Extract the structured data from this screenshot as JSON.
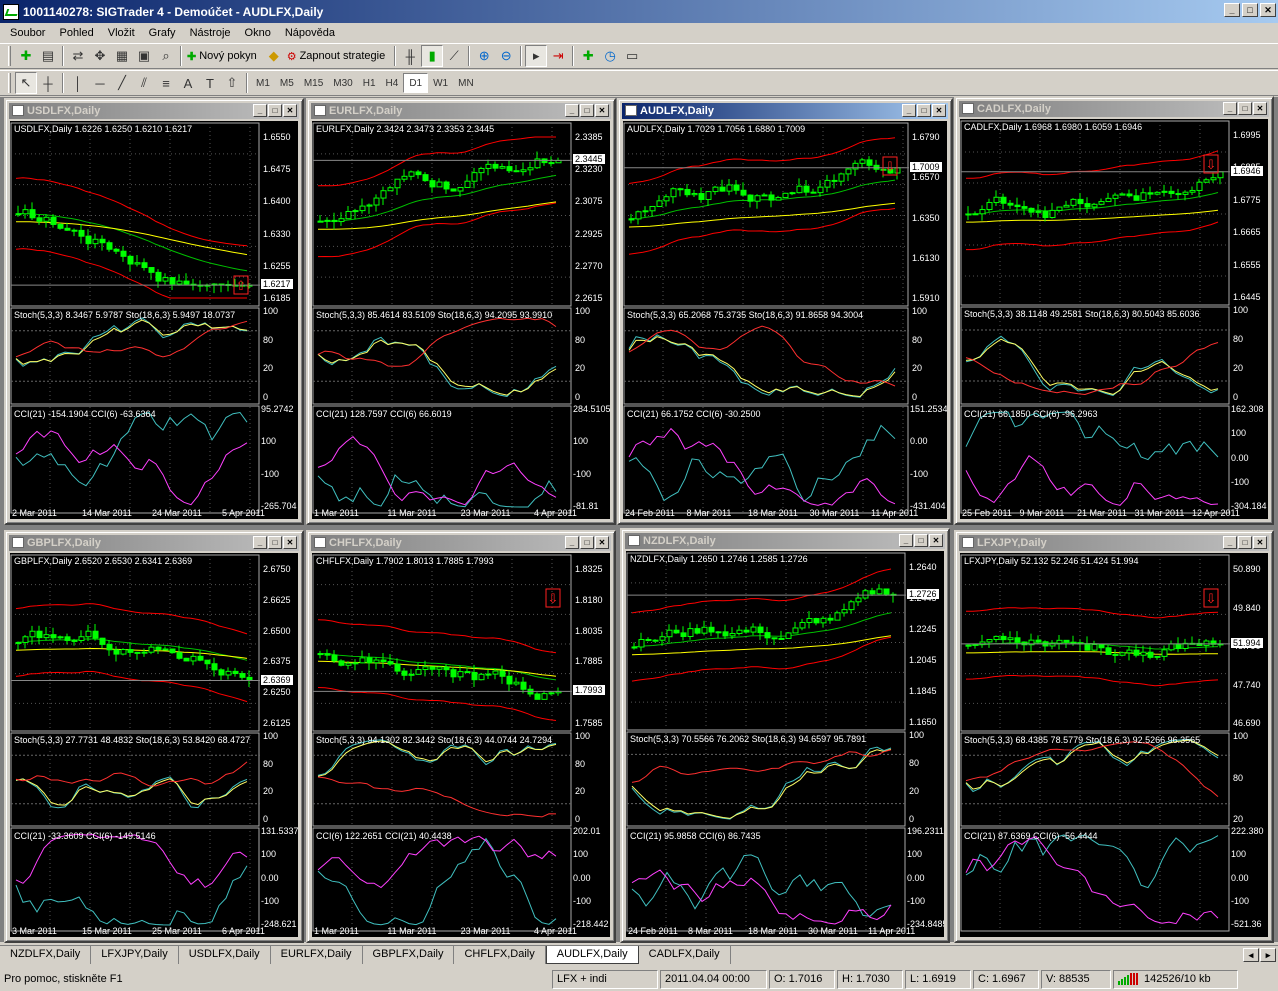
{
  "app": {
    "title": "1001140278: SIGTrader 4 - Demoúčet - AUDLFX,Daily"
  },
  "menu": [
    "Soubor",
    "Pohled",
    "Vložit",
    "Grafy",
    "Nástroje",
    "Okno",
    "Nápověda"
  ],
  "toolbar": {
    "new_order": "Nový pokyn",
    "strategy": "Zapnout strategie"
  },
  "timeframes": [
    "M1",
    "M5",
    "M15",
    "M30",
    "H1",
    "H4",
    "D1",
    "W1",
    "MN"
  ],
  "active_timeframe": "D1",
  "colors": {
    "candle_up": "#00ff00",
    "candle_down": "#00ff00",
    "bands": "#ff0000",
    "ma_fast": "#00c000",
    "ma_slow": "#ffff00",
    "stoch_main": "#ffff66",
    "stoch_signal": "#ff3030",
    "stoch_slow": "#40c0c0",
    "cci_a": "#40c0c0",
    "cci_b": "#ff40ff"
  },
  "windows": [
    {
      "title": "USDLFX,Daily",
      "header": "USDLFX,Daily  1.6226 1.6250 1.6210 1.6217",
      "prices": [
        "1.6550",
        "1.6475",
        "1.6400",
        "1.6330",
        "1.6255",
        "1.6185"
      ],
      "current": "1.6217",
      "stoch": "Stoch(5,3,3) 8.3467 5.9787  Sto(18,6,3) 5.9497 18.0737",
      "stoch_levels": [
        "100",
        "80",
        "20",
        "0"
      ],
      "cci": "CCI(21) -154.1904  CCI(6) -63.6364",
      "cci_levels": [
        "95.2742",
        "100",
        "-100",
        "-265.704"
      ],
      "dates": [
        "2 Mar 2011",
        "14 Mar 2011",
        "24 Mar 2011",
        "5 Apr 2011"
      ],
      "trend": -1,
      "arrow": "up"
    },
    {
      "title": "EURLFX,Daily",
      "header": "EURLFX,Daily  2.3424 2.3473 2.3353 2.3445",
      "prices": [
        "2.3385",
        "2.3230",
        "2.3075",
        "2.2925",
        "2.2770",
        "2.2615"
      ],
      "current": "2.3445",
      "stoch": "Stoch(5,3,3) 85.4614 83.5109  Sto(18,6,3) 94.2095 93.9910",
      "stoch_levels": [
        "100",
        "80",
        "20",
        "0"
      ],
      "cci": "CCI(21) 128.7597  CCI(6) 66.6019",
      "cci_levels": [
        "284.5105",
        "100",
        "-100",
        "-81.81"
      ],
      "dates": [
        "1 Mar 2011",
        "11 Mar 2011",
        "23 Mar 2011",
        "4 Apr 2011"
      ],
      "trend": 1,
      "arrow": ""
    },
    {
      "title": "AUDLFX,Daily",
      "header": "AUDLFX,Daily  1.7029 1.7056 1.6880 1.7009",
      "prices": [
        "1.6790",
        "1.6570",
        "1.6350",
        "1.6130",
        "1.5910"
      ],
      "current": "1.7009",
      "stoch": "Stoch(5,3,3) 65.2068 75.3735  Sto(18,6,3) 91.8658 94.3004",
      "stoch_levels": [
        "100",
        "80",
        "20",
        "0"
      ],
      "cci": "CCI(21) 66.1752  CCI(6) -30.2500",
      "cci_levels": [
        "151.2534",
        "0.00",
        "-100",
        "-431.404"
      ],
      "dates": [
        "24 Feb 2011",
        "8 Mar 2011",
        "18 Mar 2011",
        "30 Mar 2011",
        "11 Apr 2011"
      ],
      "trend": 0.5,
      "arrow": "down"
    },
    {
      "title": "CADLFX,Daily",
      "header": "CADLFX,Daily  1.6968 1.6980 1.6059 1.6946",
      "prices": [
        "1.6995",
        "1.6885",
        "1.6775",
        "1.6665",
        "1.6555",
        "1.6445"
      ],
      "current": "1.6946",
      "stoch": "Stoch(5,3,3) 38.1148 49.2581  Sto(18,6,3) 80.5043 85.6036",
      "stoch_levels": [
        "100",
        "80",
        "20",
        "0"
      ],
      "cci": "CCI(21) 66.1850  CCI(6) -96.2963",
      "cci_levels": [
        "162.308",
        "100",
        "0.00",
        "-100",
        "-304.184"
      ],
      "dates": [
        "25 Feb 2011",
        "9 Mar 2011",
        "21 Mar 2011",
        "31 Mar 2011",
        "12 Apr 2011"
      ],
      "trend": 0.6,
      "arrow": "down"
    },
    {
      "title": "GBPLFX,Daily",
      "header": "GBPLFX,Daily  2.6520 2.6530 2.6341 2.6369",
      "prices": [
        "2.6750",
        "2.6625",
        "2.6500",
        "2.6375",
        "2.6250",
        "2.6125"
      ],
      "current": "2.6369",
      "stoch": "Stoch(5,3,3) 27.7731 48.4832  Sto(18,6,3) 53.8420 68.4727",
      "stoch_levels": [
        "100",
        "80",
        "20",
        "0"
      ],
      "cci": "CCI(21) -33.3609  CCI(6) -149.5146",
      "cci_levels": [
        "131.5337",
        "100",
        "0.00",
        "-100",
        "-248.621"
      ],
      "dates": [
        "3 Mar 2011",
        "15 Mar 2011",
        "25 Mar 2011",
        "6 Apr 2011"
      ],
      "trend": -0.2,
      "arrow": ""
    },
    {
      "title": "CHFLFX,Daily",
      "header": "CHFLFX,Daily  1.7902 1.8013 1.7885 1.7993",
      "prices": [
        "1.8325",
        "1.8180",
        "1.8035",
        "1.7885",
        "1.7735",
        "1.7585"
      ],
      "current": "1.7993",
      "stoch": "Stoch(5,3,3) 94.1302 82.3442  Sto(18,6,3) 44.0744 24.7294",
      "stoch_levels": [
        "100",
        "80",
        "20",
        "0"
      ],
      "cci": "CCI(6) 122.2651  CCI(21) 40.4438",
      "cci_levels": [
        "202.01",
        "100",
        "0.00",
        "-100",
        "-218.442"
      ],
      "dates": [
        "1 Mar 2011",
        "11 Mar 2011",
        "23 Mar 2011",
        "4 Apr 2011"
      ],
      "trend": -0.4,
      "arrow": "down"
    },
    {
      "title": "NZDLFX,Daily",
      "header": "NZDLFX,Daily  1.2650 1.2746 1.2585 1.2726",
      "prices": [
        "1.2640",
        "1.2445",
        "1.2245",
        "1.2045",
        "1.1845",
        "1.1650"
      ],
      "current": "1.2726",
      "stoch": "Stoch(5,3,3) 70.5566 76.2062  Sto(18,6,3) 94.6597 95.7891",
      "stoch_levels": [
        "100",
        "80",
        "20",
        "0"
      ],
      "cci": "CCI(21) 95.9858  CCI(6) 86.7435",
      "cci_levels": [
        "196.2311",
        "100",
        "0.00",
        "-100",
        "-234.8485"
      ],
      "dates": [
        "24 Feb 2011",
        "8 Mar 2011",
        "18 Mar 2011",
        "30 Mar 2011",
        "11 Apr 2011"
      ],
      "trend": 0.7,
      "arrow": ""
    },
    {
      "title": "LFXJPY,Daily",
      "header": "LFXJPY,Daily  52.132 52.246 51.424 51.994",
      "prices": [
        "50.890",
        "49.840",
        "48.790",
        "47.740",
        "46.690"
      ],
      "current": "51.994",
      "stoch": "Stoch(5,3,3) 68.4385 78.5779  Sto(18,6,3) 92.5266 96.3565",
      "stoch_levels": [
        "100",
        "80",
        "20"
      ],
      "cci": "CCI(21) 87.6369  CCI(6) -56.4444",
      "cci_levels": [
        "222.380",
        "100",
        "0.00",
        "-100",
        "-521.36"
      ],
      "dates": [],
      "trend": 0.8,
      "arrow": "down"
    }
  ],
  "tabs": [
    "NZDLFX,Daily",
    "LFXJPY,Daily",
    "USDLFX,Daily",
    "EURLFX,Daily",
    "GBPLFX,Daily",
    "CHFLFX,Daily",
    "AUDLFX,Daily",
    "CADLFX,Daily"
  ],
  "active_tab": "AUDLFX,Daily",
  "status": {
    "help": "Pro pomoc, stiskněte F1",
    "profile": "LFX + indi",
    "datetime": "2011.04.04 00:00",
    "open": "O: 1.7016",
    "high": "H: 1.7030",
    "low": "L: 1.6919",
    "close": "C: 1.6967",
    "volume": "V: 88535",
    "traffic": "142526/10 kb"
  }
}
